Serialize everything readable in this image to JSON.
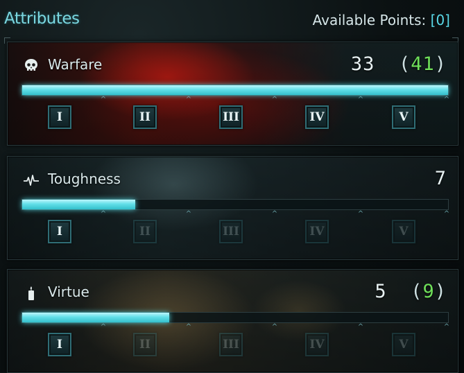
{
  "header": {
    "title": "Attributes",
    "available_label": "Available Points:",
    "available_value": "[0]"
  },
  "attributes": [
    {
      "name": "Warfare",
      "icon": "skull-icon",
      "value": "33",
      "bonus": "41",
      "progress": 1.0,
      "tiers": [
        {
          "label": "I",
          "unlocked": true
        },
        {
          "label": "II",
          "unlocked": true
        },
        {
          "label": "III",
          "unlocked": true
        },
        {
          "label": "IV",
          "unlocked": true
        },
        {
          "label": "V",
          "unlocked": true
        }
      ]
    },
    {
      "name": "Toughness",
      "icon": "heartbeat-icon",
      "value": "7",
      "bonus": "",
      "progress": 0.265,
      "tiers": [
        {
          "label": "I",
          "unlocked": true
        },
        {
          "label": "II",
          "unlocked": false
        },
        {
          "label": "III",
          "unlocked": false
        },
        {
          "label": "IV",
          "unlocked": false
        },
        {
          "label": "V",
          "unlocked": false
        }
      ]
    },
    {
      "name": "Virtue",
      "icon": "candle-icon",
      "value": "5",
      "bonus": "9",
      "progress": 0.345,
      "tiers": [
        {
          "label": "I",
          "unlocked": true
        },
        {
          "label": "II",
          "unlocked": false
        },
        {
          "label": "III",
          "unlocked": false
        },
        {
          "label": "IV",
          "unlocked": false
        },
        {
          "label": "V",
          "unlocked": false
        }
      ]
    }
  ],
  "colors": {
    "accent": "#59d8e6",
    "bonus": "#6fe05a",
    "bar_fill": "#62dfe9"
  }
}
